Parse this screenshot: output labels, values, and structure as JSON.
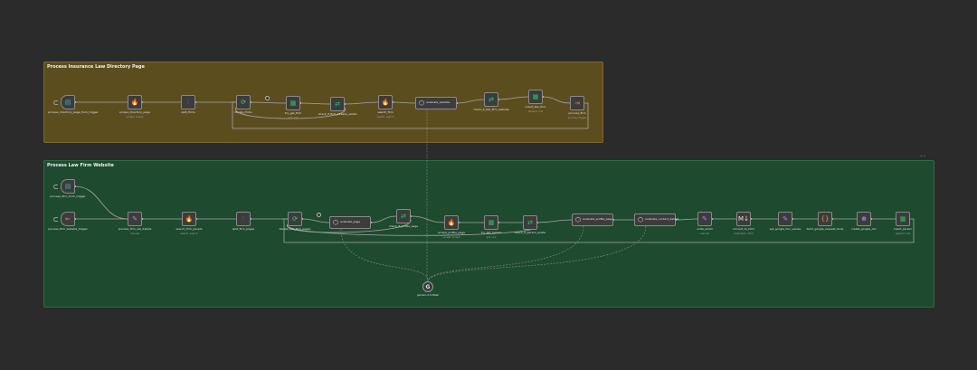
{
  "colors": {
    "background": "#2b2b2b",
    "sticky_yellow": "#5c4d1f",
    "sticky_yellow_border": "#7d6a2a",
    "sticky_green": "#1e4a2f",
    "sticky_green_border": "#2e6a45",
    "node_fill": "#3c3c3c",
    "node_border": "#8a8a8a",
    "connection": "#9a9a9a"
  },
  "stickies": [
    {
      "id": "sticky_insurance",
      "title": "Process Insurance Law Directory Page"
    },
    {
      "id": "sticky_lawfirm",
      "title": "Process Law Firm Website"
    }
  ],
  "nodes": [
    {
      "id": "n1",
      "label": "process_directory_page_form_trigger",
      "subtitle": "",
      "icon": "form-icon",
      "glyph": "▤",
      "color": "#2fb6b0",
      "shape": "square",
      "trigger": true
    },
    {
      "id": "n2",
      "label": "scrape_directory_page",
      "subtitle": "scrape: scrape",
      "icon": "fire-icon",
      "glyph": "🔥",
      "color": "#f07a1a",
      "shape": "square"
    },
    {
      "id": "n3",
      "label": "split_firms",
      "subtitle": "",
      "icon": "split-icon",
      "glyph": "⫶",
      "color": "#8b7cf6",
      "shape": "square"
    },
    {
      "id": "n4",
      "label": "iterate_firms",
      "subtitle": "",
      "icon": "loop-icon",
      "glyph": "⟳",
      "color": "#3fd98a",
      "shape": "square",
      "loop": true
    },
    {
      "id": "n5",
      "label": "try_get_firm",
      "subtitle": "get: row",
      "icon": "sheet-icon",
      "glyph": "▦",
      "color": "#22c55e",
      "shape": "square"
    },
    {
      "id": "n6",
      "label": "check_if_firm_already_exists",
      "subtitle": "",
      "icon": "filter-icon",
      "glyph": "⇄",
      "color": "#22c55e",
      "shape": "square"
    },
    {
      "id": "n7",
      "label": "search_firm",
      "subtitle": "search: search",
      "icon": "fire-icon",
      "glyph": "🔥",
      "color": "#f07a1a",
      "shape": "square"
    },
    {
      "id": "n8",
      "label": "evaluate_website",
      "subtitle": "",
      "icon": "agent-icon",
      "glyph": "⬡",
      "color": "#e6e6e6",
      "shape": "wide"
    },
    {
      "id": "n9",
      "label": "check_if_law_firm_website",
      "subtitle": "",
      "icon": "filter-icon",
      "glyph": "⇄",
      "color": "#22c55e",
      "shape": "square"
    },
    {
      "id": "n10",
      "label": "insert_law_firm",
      "subtitle": "append: row",
      "icon": "sheet-icon",
      "glyph": "▦",
      "color": "#22c55e",
      "shape": "square"
    },
    {
      "id": "n11",
      "label": "process_firm",
      "subtitle": "process: trigger",
      "icon": "exec-icon",
      "glyph": "⇥",
      "color": "#f06a75",
      "shape": "square"
    },
    {
      "id": "m1",
      "label": "process_firm_form_trigger",
      "subtitle": "",
      "icon": "form-icon",
      "glyph": "▤",
      "color": "#2fb6b0",
      "shape": "square",
      "trigger": true
    },
    {
      "id": "m2",
      "label": "process_firm_website_trigger",
      "subtitle": "",
      "icon": "exec-trigger-icon",
      "glyph": "⇤",
      "color": "#f06a75",
      "shape": "square",
      "trigger": true
    },
    {
      "id": "m3",
      "label": "process_firm_set_details",
      "subtitle": "manual",
      "icon": "pencil-icon",
      "glyph": "✎",
      "color": "#a78bfa",
      "shape": "square"
    },
    {
      "id": "m4",
      "label": "search_firm_people",
      "subtitle": "search: search",
      "icon": "fire-icon",
      "glyph": "🔥",
      "color": "#f07a1a",
      "shape": "square"
    },
    {
      "id": "m5",
      "label": "split_firm_pages",
      "subtitle": "",
      "icon": "split-icon",
      "glyph": "⫶",
      "color": "#8b7cf6",
      "shape": "square"
    },
    {
      "id": "m6",
      "label": "iterate_law_firm_pages",
      "subtitle": "",
      "icon": "loop-icon",
      "glyph": "⟳",
      "color": "#3fd98a",
      "shape": "square",
      "loop": true
    },
    {
      "id": "m7",
      "label": "evaluate_page",
      "subtitle": "",
      "icon": "agent-icon",
      "glyph": "⬡",
      "color": "#e6e6e6",
      "shape": "wide"
    },
    {
      "id": "m8",
      "label": "check_if_profile_page",
      "subtitle": "",
      "icon": "filter-icon",
      "glyph": "⇄",
      "color": "#22c55e",
      "shape": "square"
    },
    {
      "id": "m9",
      "label": "scrape_profile_page",
      "subtitle": "scrape: scrape",
      "icon": "fire-icon",
      "glyph": "🔥",
      "color": "#f07a1a",
      "shape": "square"
    },
    {
      "id": "m10",
      "label": "try_get_person",
      "subtitle": "get: row",
      "icon": "sheet-icon",
      "glyph": "▦",
      "color": "#22c55e",
      "shape": "square"
    },
    {
      "id": "m11",
      "label": "check_if_person_exists",
      "subtitle": "",
      "icon": "filter-icon",
      "glyph": "⇄",
      "color": "#22c55e",
      "shape": "square"
    },
    {
      "id": "m12",
      "label": "evaluate_profile_page",
      "subtitle": "",
      "icon": "agent-icon",
      "glyph": "⬡",
      "color": "#e6e6e6",
      "shape": "wide"
    },
    {
      "id": "m13",
      "label": "evaluate_contact_details",
      "subtitle": "",
      "icon": "agent-icon",
      "glyph": "⬡",
      "color": "#e6e6e6",
      "shape": "wide"
    },
    {
      "id": "m14",
      "label": "write_email",
      "subtitle": "manual",
      "icon": "pencil-icon",
      "glyph": "✎",
      "color": "#a78bfa",
      "shape": "square"
    },
    {
      "id": "m15",
      "label": "convert_to_html",
      "subtitle": "markdown: html",
      "icon": "markdown-icon",
      "glyph": "M↓",
      "color": "#e6e6e6",
      "shape": "square"
    },
    {
      "id": "m16",
      "label": "set_google_doc_values",
      "subtitle": "",
      "icon": "pencil-icon",
      "glyph": "✎",
      "color": "#a78bfa",
      "shape": "square"
    },
    {
      "id": "m17",
      "label": "build_google_request_body",
      "subtitle": "",
      "icon": "code-icon",
      "glyph": "{}",
      "color": "#f59e0b",
      "shape": "square"
    },
    {
      "id": "m18",
      "label": "create_google_doc",
      "subtitle": "",
      "icon": "globe-icon",
      "glyph": "⊕",
      "color": "#a5b4fc",
      "shape": "square"
    },
    {
      "id": "m19",
      "label": "insert_person",
      "subtitle": "append: row",
      "icon": "sheet-icon",
      "glyph": "▦",
      "color": "#22c55e",
      "shape": "square"
    },
    {
      "id": "g1",
      "label": "gemini-2.5-flash",
      "subtitle": "",
      "icon": "gemini-icon",
      "glyph": "G",
      "color": "#e6e6e6",
      "shape": "circle"
    }
  ]
}
